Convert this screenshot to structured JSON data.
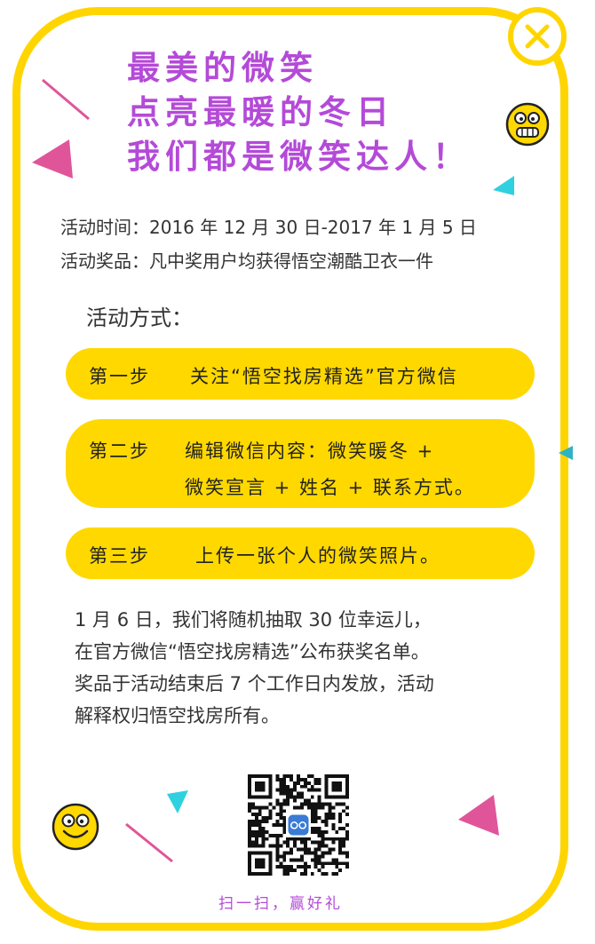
{
  "title": {
    "line1": "最美的微笑",
    "line2": "点亮最暖的冬日",
    "line3": "我们都是微笑达人！"
  },
  "info": {
    "time": "活动时间：2016 年 12 月 30 日-2017 年 1 月 5 日",
    "prize": "活动奖品：凡中奖用户均获得悟空潮酷卫衣一件"
  },
  "method_title": "活动方式：",
  "steps": [
    {
      "num": "第一步",
      "text": "关注“悟空找房精选”官方微信"
    },
    {
      "num": "第二步",
      "text": "编辑微信内容：微笑暖冬 +",
      "text2": "微笑宣言 + 姓名 + 联系方式。"
    },
    {
      "num": "第三步",
      "text": "上传一张个人的微笑照片。"
    }
  ],
  "paragraph": [
    "1 月 6 日，我们将随机抽取 30 位幸运儿，",
    "在官方微信“悟空找房精选”公布获奖名单。",
    "奖品于活动结束后 7 个工作日内发放，活动",
    "解释权归悟空找房所有。"
  ],
  "qr_caption": "扫一扫，赢好礼",
  "icons": {
    "close": "close-icon",
    "smiley_top": "grinning-face-icon",
    "smiley_bottom": "smiling-face-icon",
    "qr": "qr-code-icon"
  },
  "colors": {
    "border": "#ffd500",
    "title": "#b44ad8",
    "step_bg": "#ffd800",
    "pink": "#e0559a",
    "cyan": "#2fd1e0"
  }
}
